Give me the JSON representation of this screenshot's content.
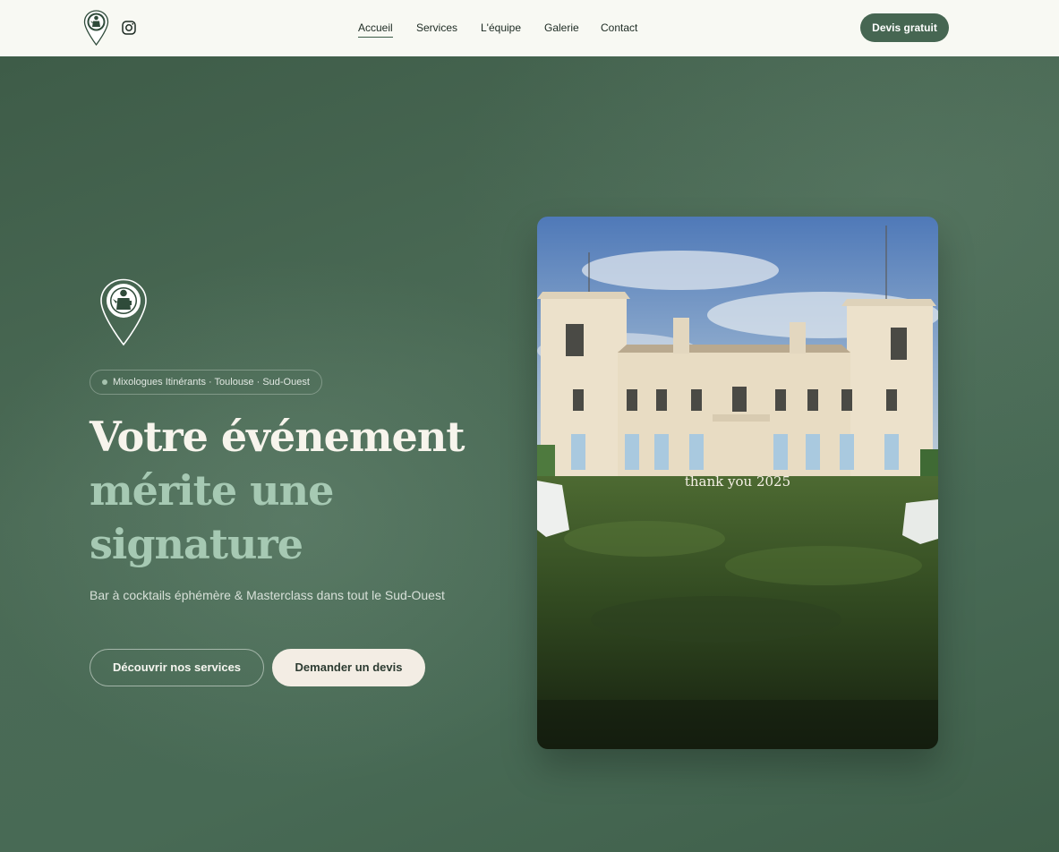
{
  "nav": {
    "logo_icon": "bartender-map-pin-logo",
    "instagram_icon": "instagram-icon",
    "items": [
      {
        "label": "Accueil",
        "active": true
      },
      {
        "label": "Services",
        "active": false
      },
      {
        "label": "L'équipe",
        "active": false
      },
      {
        "label": "Galerie",
        "active": false
      },
      {
        "label": "Contact",
        "active": false
      }
    ],
    "cta_label": "Devis gratuit"
  },
  "hero": {
    "badge": "Mixologues Itinérants · Toulouse · Sud-Ouest",
    "title_line1": "Votre événement",
    "title_line2": "mérite une",
    "title_line3": "signature",
    "subtitle": "Bar à cocktails éphémère & Masterclass dans tout le Sud-Ouest",
    "primary_button": "Découvrir nos services",
    "secondary_button": "Demander un devis",
    "media_caption": "thank you 2025"
  },
  "colors": {
    "brand_green": "#466652",
    "hero_background": "#46664f",
    "nav_background": "#f8f9f3",
    "accent_light_green": "#a6c9b3",
    "cream": "#f3ede4"
  }
}
